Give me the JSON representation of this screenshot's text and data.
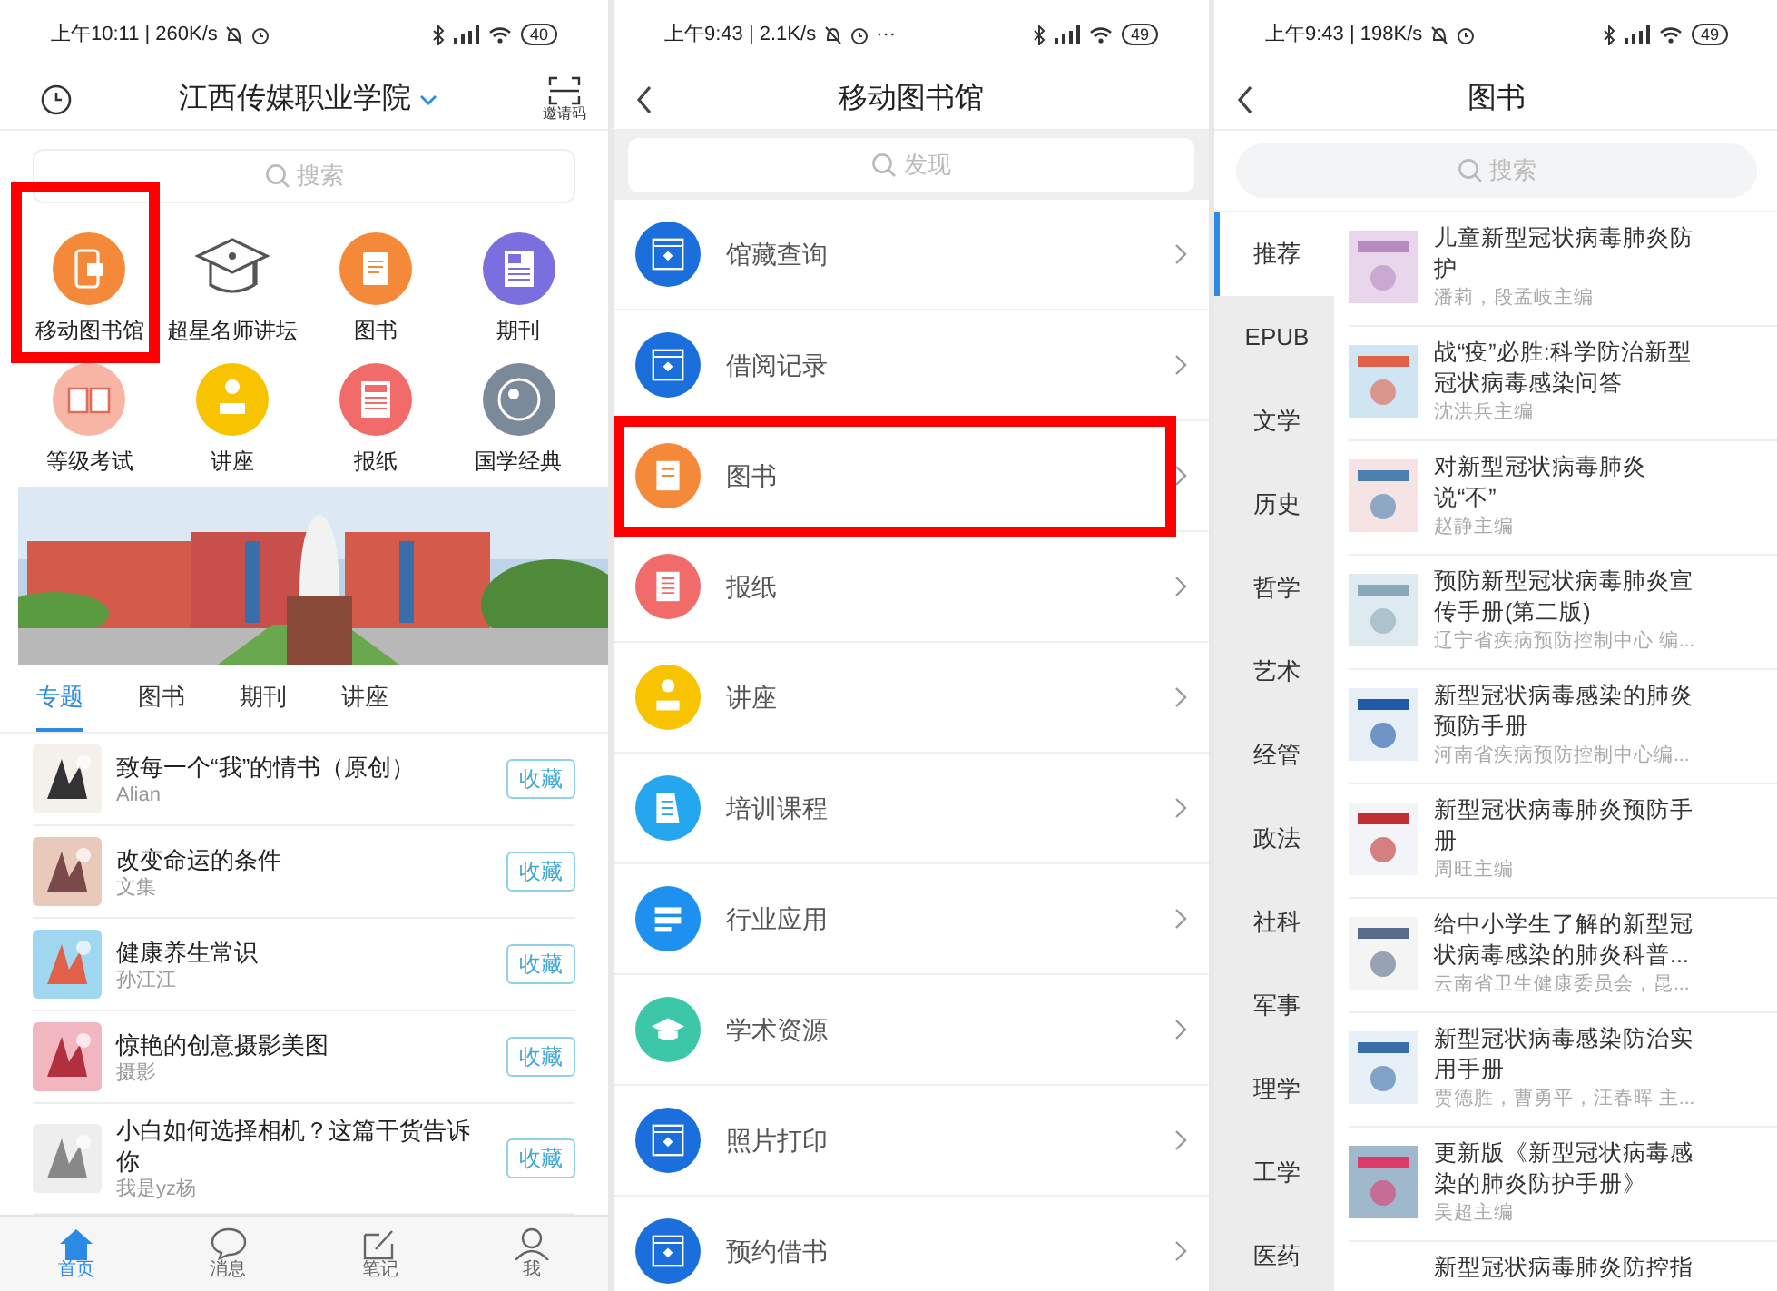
{
  "home_screen": {
    "status_bar": {
      "time": "上午10:11 | 260K/s",
      "battery": "40"
    },
    "header": {
      "title": "江西传媒职业学院",
      "invite_label": "邀请码"
    },
    "search": {
      "placeholder": "搜索"
    },
    "shortcuts": [
      {
        "label": "移动图书馆",
        "highlighted": true
      },
      {
        "label": "超星名师讲坛",
        "highlighted": false
      },
      {
        "label": "图书",
        "highlighted": false
      },
      {
        "label": "期刊",
        "highlighted": false
      },
      {
        "label": "等级考试",
        "highlighted": false
      },
      {
        "label": "讲座",
        "highlighted": false
      },
      {
        "label": "报纸",
        "highlighted": false
      },
      {
        "label": "国学经典",
        "highlighted": false
      }
    ],
    "tabs": [
      {
        "label": "专题",
        "selected": true
      },
      {
        "label": "图书",
        "selected": false
      },
      {
        "label": "期刊",
        "selected": false
      },
      {
        "label": "讲座",
        "selected": false
      }
    ],
    "feed": [
      {
        "title": "致每一个“我”的情书（原创）",
        "author": "Alian",
        "button": "收藏"
      },
      {
        "title": "改变命运的条件",
        "author": "文集",
        "button": "收藏"
      },
      {
        "title": "健康养生常识",
        "author": "孙江江",
        "button": "收藏"
      },
      {
        "title": "惊艳的创意摄影美图",
        "author": "摄影",
        "button": "收藏"
      },
      {
        "title": "小白如何选择相机？这篇干货告诉你",
        "author": "我是yz杨",
        "button": "收藏"
      }
    ],
    "bottom_nav": [
      {
        "label": "首页",
        "selected": true
      },
      {
        "label": "消息",
        "selected": false
      },
      {
        "label": "笔记",
        "selected": false
      },
      {
        "label": "我",
        "selected": false
      }
    ]
  },
  "library_screen": {
    "status_bar": {
      "time": "上午9:43 | 2.1K/s",
      "more": "···",
      "battery": "49"
    },
    "header": {
      "title": "移动图书馆"
    },
    "search": {
      "placeholder": "发现"
    },
    "menu": [
      {
        "label": "馆藏查询",
        "highlighted": false
      },
      {
        "label": "借阅记录",
        "highlighted": false
      },
      {
        "label": "图书",
        "highlighted": true
      },
      {
        "label": "报纸",
        "highlighted": false
      },
      {
        "label": "讲座",
        "highlighted": false
      },
      {
        "label": "培训课程",
        "highlighted": false
      },
      {
        "label": "行业应用",
        "highlighted": false
      },
      {
        "label": "学术资源",
        "highlighted": false
      },
      {
        "label": "照片打印",
        "highlighted": false
      },
      {
        "label": "预约借书",
        "highlighted": false
      }
    ]
  },
  "books_screen": {
    "status_bar": {
      "time": "上午9:43 | 198K/s",
      "battery": "49"
    },
    "header": {
      "title": "图书"
    },
    "search": {
      "placeholder": "搜索"
    },
    "categories": [
      {
        "label": "推荐",
        "selected": true
      },
      {
        "label": "EPUB",
        "selected": false
      },
      {
        "label": "文学",
        "selected": false
      },
      {
        "label": "历史",
        "selected": false
      },
      {
        "label": "哲学",
        "selected": false
      },
      {
        "label": "艺术",
        "selected": false
      },
      {
        "label": "经管",
        "selected": false
      },
      {
        "label": "政法",
        "selected": false
      },
      {
        "label": "社科",
        "selected": false
      },
      {
        "label": "军事",
        "selected": false
      },
      {
        "label": "理学",
        "selected": false
      },
      {
        "label": "工学",
        "selected": false
      },
      {
        "label": "医药",
        "selected": false
      }
    ],
    "books": [
      {
        "title": "儿童新型冠状病毒肺炎防护",
        "author": "潘莉，段孟岐主编"
      },
      {
        "title": "战“疫”必胜:科学防治新型冠状病毒感染问答",
        "author": "沈洪兵主编"
      },
      {
        "title": "对新型冠状病毒肺炎说“不”",
        "author": "赵静主编"
      },
      {
        "title": "预防新型冠状病毒肺炎宣传手册(第二版)",
        "author": "辽宁省疾病预防控制中心 编..."
      },
      {
        "title": "新型冠状病毒感染的肺炎预防手册",
        "author": "河南省疾病预防控制中心编..."
      },
      {
        "title": "新型冠状病毒肺炎预防手册",
        "author": "周旺主编"
      },
      {
        "title": "给中小学生了解的新型冠状病毒感染的肺炎科普...",
        "author": "云南省卫生健康委员会，昆..."
      },
      {
        "title": "新型冠状病毒感染防治实用手册",
        "author": "贾德胜，曹勇平，汪春晖 主..."
      },
      {
        "title": "更新版《新型冠状病毒感染的肺炎防护手册》",
        "author": "吴超主编"
      },
      {
        "title": "新型冠状病毒肺炎防控指"
      }
    ]
  }
}
